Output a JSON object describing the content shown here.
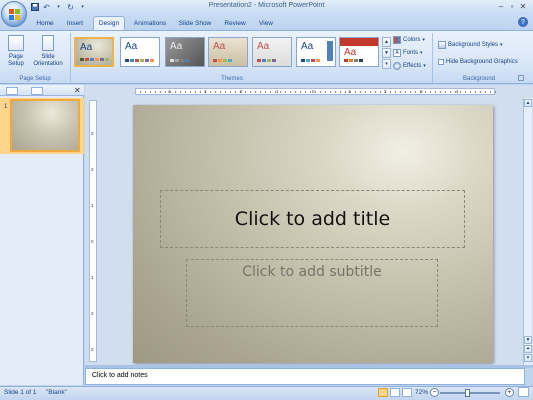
{
  "window": {
    "title": "Presentation2 - Microsoft PowerPoint"
  },
  "tabs": [
    {
      "label": "Home"
    },
    {
      "label": "Insert"
    },
    {
      "label": "Design",
      "active": true
    },
    {
      "label": "Animations"
    },
    {
      "label": "Slide Show"
    },
    {
      "label": "Review"
    },
    {
      "label": "View"
    }
  ],
  "ribbon": {
    "page_setup": {
      "page_setup_label": "Page\nSetup",
      "orientation_label": "Slide\nOrientation",
      "group_label": "Page Setup"
    },
    "themes": {
      "group_label": "Themes",
      "sample_text": "Aa"
    },
    "theme_options": {
      "colors": "Colors",
      "fonts": "Fonts",
      "effects": "Effects"
    },
    "background": {
      "styles": "Background Styles",
      "hide_graphics": "Hide Background Graphics",
      "group_label": "Background"
    }
  },
  "left_pane": {
    "slide_number": "1"
  },
  "slide": {
    "title_placeholder": "Click to add title",
    "subtitle_placeholder": "Click to add subtitle"
  },
  "notes": {
    "placeholder": "Click to add notes"
  },
  "status": {
    "slide_position": "Slide 1 of 1",
    "theme_name": "\"Blank\"",
    "zoom": "72%"
  },
  "ruler": {
    "h_numbers": [
      "4",
      "3",
      "2",
      "1",
      "0",
      "1",
      "2",
      "3",
      "4"
    ],
    "v_numbers": [
      "3",
      "2",
      "1",
      "0",
      "1",
      "2",
      "3"
    ]
  },
  "colors": {
    "ribbon_blue": "#15428b",
    "selection_orange": "#f0b24a"
  }
}
